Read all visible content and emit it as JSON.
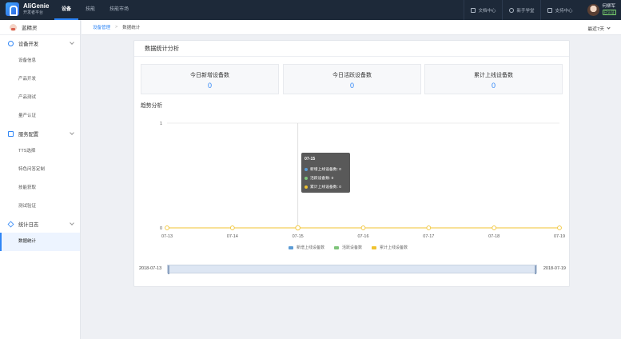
{
  "brand": {
    "title": "AliGenie",
    "subtitle": "开发者平台"
  },
  "nav": {
    "items": [
      "设备",
      "技能",
      "技能市场"
    ],
    "active": 0
  },
  "top_links": [
    "文档中心",
    "新手学堂",
    "支持中心"
  ],
  "user": {
    "name": "何柳军",
    "badge": "已认证"
  },
  "device": {
    "name": "蓝精灵"
  },
  "sidebar": {
    "groups": [
      {
        "label": "设备开发",
        "items": [
          "设备信息",
          "产品开发",
          "产品测试",
          "量产认证"
        ]
      },
      {
        "label": "服务配置",
        "items": [
          "TTS选择",
          "特色问答定制",
          "技能获取",
          "测试验证"
        ]
      },
      {
        "label": "统计日志",
        "items": [
          "数据统计"
        ]
      }
    ],
    "active_item": "数据统计"
  },
  "breadcrumb": {
    "parent": "设备管理",
    "current": "数据统计"
  },
  "range_select": "最近7天",
  "panel": {
    "title": "数据统计分析",
    "trend_title": "趋势分析"
  },
  "stats": [
    {
      "label": "今日新增设备数",
      "value": "0"
    },
    {
      "label": "今日活跃设备数",
      "value": "0"
    },
    {
      "label": "累计上线设备数",
      "value": "0"
    }
  ],
  "tooltip": {
    "date": "07-15",
    "rows": [
      "新增上线设备数: 0",
      "活跃设备数: 0",
      "累计上线设备数: 0"
    ]
  },
  "colors": {
    "accent": "#2f86f6",
    "series_new": "#5b9bd5",
    "series_active": "#7ec47a",
    "series_total": "#f0c330"
  },
  "chart_data": {
    "type": "line",
    "x": [
      "07-13",
      "07-14",
      "07-15",
      "07-16",
      "07-17",
      "07-18",
      "07-19"
    ],
    "series": [
      {
        "name": "新增上线设备数",
        "values": [
          0,
          0,
          0,
          0,
          0,
          0,
          0
        ]
      },
      {
        "name": "活跃设备数",
        "values": [
          0,
          0,
          0,
          0,
          0,
          0,
          0
        ]
      },
      {
        "name": "累计上线设备数",
        "values": [
          0,
          0,
          0,
          0,
          0,
          0,
          0
        ]
      }
    ],
    "ylim": [
      0,
      1
    ],
    "yticks": [
      "0",
      "1"
    ],
    "highlight": "07-15",
    "grid": true,
    "legend": "bottom"
  },
  "date_slider": {
    "start": "2018-07-13",
    "end": "2018-07-19"
  }
}
